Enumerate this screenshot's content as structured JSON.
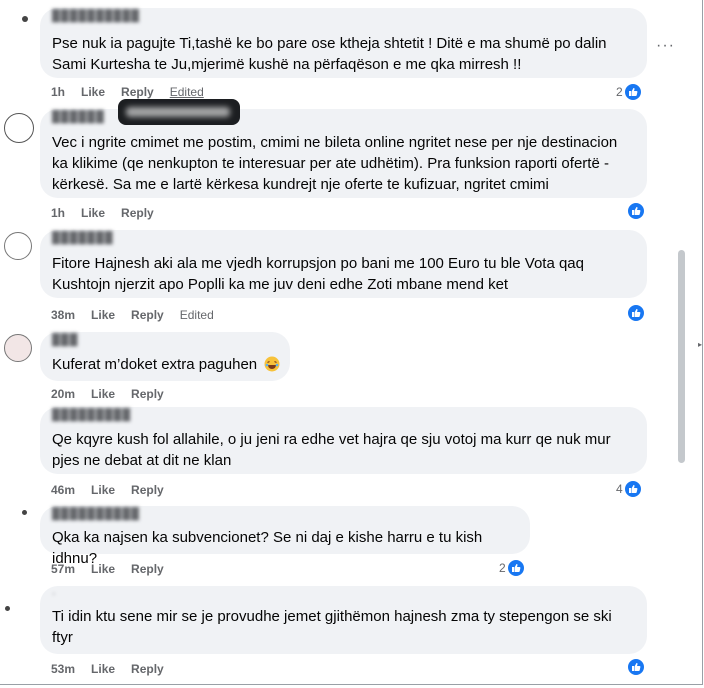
{
  "comments": [
    {
      "text": [
        "Pse nuk ia pagujte Ti,tashë ke bo pare ose ktheja shtetit ! Ditë e ma shumë po dalin",
        "Sami Kurtesha te Ju,mjerimë kushë na përfaqëson e me qka mirresh !!"
      ],
      "time": "1h",
      "like": "Like",
      "reply": "Reply",
      "edited": "Edited",
      "reactions": "2"
    },
    {
      "text": [
        "Vec i ngrite cmimet me postim, cmimi ne bileta online ngritet nese per nje destinacion",
        "ka klikime (qe nenkupton te interesuar per ate udhëtim). Pra funksion raporti ofertë -",
        "kërkesë. Sa me e lartë kërkesa kundrejt nje oferte te kufizuar, ngritet cmimi"
      ],
      "time": "1h",
      "like": "Like",
      "reply": "Reply",
      "reactions": ""
    },
    {
      "text": [
        "Fitore Hajnesh aki ala me vjedh korrupsjon po bani me 100 Euro tu ble Vota qaq",
        "Kushtojn njerzit apo Poplli ka me juv deni edhe Zoti mbane mend ket"
      ],
      "time": "38m",
      "like": "Like",
      "reply": "Reply",
      "edited": "Edited",
      "reactions": ""
    },
    {
      "text": [
        "Kuferat m’doket extra paguhen"
      ],
      "time": "20m",
      "like": "Like",
      "reply": "Reply",
      "reactions": ""
    },
    {
      "text": [
        "Qe kqyre kush fol allahile, o ju jeni ra edhe vet hajra qe sju votoj ma kurr qe nuk mur",
        "pjes ne debat at dit ne klan"
      ],
      "time": "46m",
      "like": "Like",
      "reply": "Reply",
      "reactions": "4"
    },
    {
      "text": [
        "Qka ka najsen ka subvencionet? Se ni daj e kishe harru e tu kish idhnu?"
      ],
      "time": "57m",
      "like": "Like",
      "reply": "Reply",
      "reactions": "2"
    },
    {
      "text": [
        "Ti idin ktu sene mir se je provudhe jemet gjithëmon hajnesh zma ty stepengon se ski",
        "ftyr"
      ],
      "time": "53m",
      "like": "Like",
      "reply": "Reply",
      "reactions": ""
    }
  ],
  "more_label": "···",
  "icons": {
    "like": "like-thumb-icon",
    "more": "more-options-icon",
    "emoji": "laughing-emoji-icon"
  },
  "colors": {
    "bubble": "#f0f2f5",
    "like_blue": "#1877f2",
    "meta_gray": "#65676b"
  }
}
